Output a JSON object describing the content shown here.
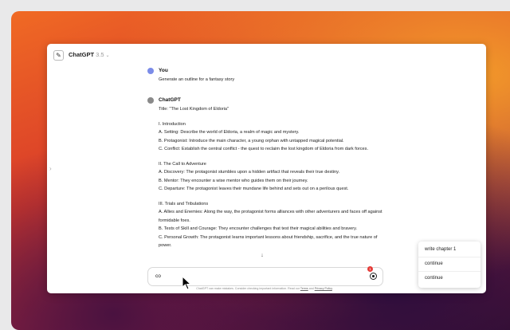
{
  "header": {
    "model_name": "ChatGPT",
    "model_version": "3.5",
    "new_chat_icon": "edit-icon"
  },
  "conversation": {
    "user": {
      "name": "You",
      "message": "Generate an outline for a fantasy story"
    },
    "assistant": {
      "name": "ChatGPT",
      "title": "Title: \"The Lost Kingdom of Eldoria\"",
      "sections": [
        {
          "heading": "I. Introduction",
          "items": [
            "A. Setting: Describe the world of Eldoria, a realm of magic and mystery.",
            "B. Protagonist: Introduce the main character, a young orphan with untapped magical potential.",
            "C. Conflict: Establish the central conflict - the quest to reclaim the lost kingdom of Eldoria from dark forces."
          ]
        },
        {
          "heading": "II. The Call to Adventure",
          "items": [
            "A. Discovery: The protagonist stumbles upon a hidden artifact that reveals their true destiny.",
            "B. Mentor: They encounter a wise mentor who guides them on their journey.",
            "C. Departure: The protagonist leaves their mundane life behind and sets out on a perilous quest."
          ]
        },
        {
          "heading": "III. Trials and Tribulations",
          "items": [
            "A. Allies and Enemies: Along the way, the protagonist forms alliances with other adventurers and faces off against formidable foes.",
            "B. Tests of Skill and Courage: They encounter challenges that test their magical abilities and bravery.",
            "C. Personal Growth: The protagonist learns important lessons about friendship, sacrifice, and the true nature of power."
          ]
        }
      ]
    }
  },
  "composer": {
    "value": "co",
    "notification_count": "1"
  },
  "disclaimer": {
    "text": "ChatGPT can make mistakes. Consider checking important information. Read our",
    "terms": "Terms",
    "and": "and",
    "privacy": "Privacy Policy",
    "end": "."
  },
  "suggestions": [
    "write chapter 1",
    "continue",
    "continue"
  ],
  "colors": {
    "user_avatar": "#7b8ce8",
    "assistant_avatar": "#8a8a8a",
    "notification": "#e53935"
  }
}
